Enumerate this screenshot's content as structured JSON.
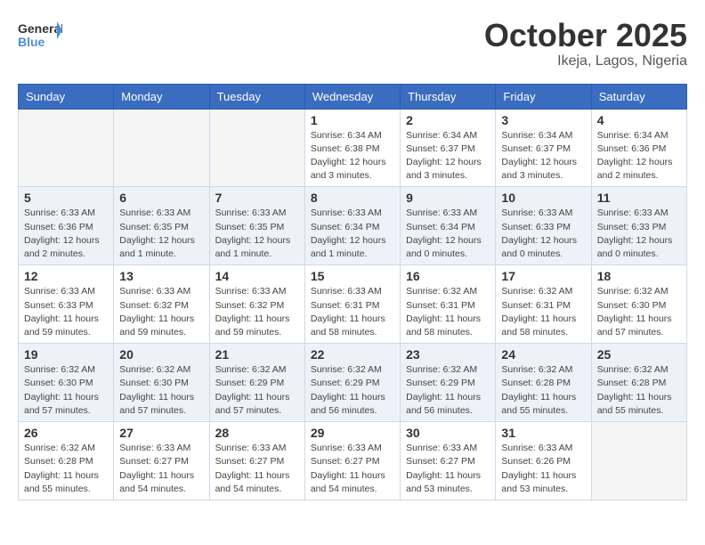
{
  "logo": {
    "line1": "General",
    "line2": "Blue"
  },
  "title": "October 2025",
  "subtitle": "Ikeja, Lagos, Nigeria",
  "weekdays": [
    "Sunday",
    "Monday",
    "Tuesday",
    "Wednesday",
    "Thursday",
    "Friday",
    "Saturday"
  ],
  "weeks": [
    [
      {
        "day": "",
        "empty": true
      },
      {
        "day": "",
        "empty": true
      },
      {
        "day": "",
        "empty": true
      },
      {
        "day": "1",
        "sunrise": "Sunrise: 6:34 AM",
        "sunset": "Sunset: 6:38 PM",
        "daylight": "Daylight: 12 hours and 3 minutes."
      },
      {
        "day": "2",
        "sunrise": "Sunrise: 6:34 AM",
        "sunset": "Sunset: 6:37 PM",
        "daylight": "Daylight: 12 hours and 3 minutes."
      },
      {
        "day": "3",
        "sunrise": "Sunrise: 6:34 AM",
        "sunset": "Sunset: 6:37 PM",
        "daylight": "Daylight: 12 hours and 3 minutes."
      },
      {
        "day": "4",
        "sunrise": "Sunrise: 6:34 AM",
        "sunset": "Sunset: 6:36 PM",
        "daylight": "Daylight: 12 hours and 2 minutes."
      }
    ],
    [
      {
        "day": "5",
        "sunrise": "Sunrise: 6:33 AM",
        "sunset": "Sunset: 6:36 PM",
        "daylight": "Daylight: 12 hours and 2 minutes."
      },
      {
        "day": "6",
        "sunrise": "Sunrise: 6:33 AM",
        "sunset": "Sunset: 6:35 PM",
        "daylight": "Daylight: 12 hours and 1 minute."
      },
      {
        "day": "7",
        "sunrise": "Sunrise: 6:33 AM",
        "sunset": "Sunset: 6:35 PM",
        "daylight": "Daylight: 12 hours and 1 minute."
      },
      {
        "day": "8",
        "sunrise": "Sunrise: 6:33 AM",
        "sunset": "Sunset: 6:34 PM",
        "daylight": "Daylight: 12 hours and 1 minute."
      },
      {
        "day": "9",
        "sunrise": "Sunrise: 6:33 AM",
        "sunset": "Sunset: 6:34 PM",
        "daylight": "Daylight: 12 hours and 0 minutes."
      },
      {
        "day": "10",
        "sunrise": "Sunrise: 6:33 AM",
        "sunset": "Sunset: 6:33 PM",
        "daylight": "Daylight: 12 hours and 0 minutes."
      },
      {
        "day": "11",
        "sunrise": "Sunrise: 6:33 AM",
        "sunset": "Sunset: 6:33 PM",
        "daylight": "Daylight: 12 hours and 0 minutes."
      }
    ],
    [
      {
        "day": "12",
        "sunrise": "Sunrise: 6:33 AM",
        "sunset": "Sunset: 6:33 PM",
        "daylight": "Daylight: 11 hours and 59 minutes."
      },
      {
        "day": "13",
        "sunrise": "Sunrise: 6:33 AM",
        "sunset": "Sunset: 6:32 PM",
        "daylight": "Daylight: 11 hours and 59 minutes."
      },
      {
        "day": "14",
        "sunrise": "Sunrise: 6:33 AM",
        "sunset": "Sunset: 6:32 PM",
        "daylight": "Daylight: 11 hours and 59 minutes."
      },
      {
        "day": "15",
        "sunrise": "Sunrise: 6:33 AM",
        "sunset": "Sunset: 6:31 PM",
        "daylight": "Daylight: 11 hours and 58 minutes."
      },
      {
        "day": "16",
        "sunrise": "Sunrise: 6:32 AM",
        "sunset": "Sunset: 6:31 PM",
        "daylight": "Daylight: 11 hours and 58 minutes."
      },
      {
        "day": "17",
        "sunrise": "Sunrise: 6:32 AM",
        "sunset": "Sunset: 6:31 PM",
        "daylight": "Daylight: 11 hours and 58 minutes."
      },
      {
        "day": "18",
        "sunrise": "Sunrise: 6:32 AM",
        "sunset": "Sunset: 6:30 PM",
        "daylight": "Daylight: 11 hours and 57 minutes."
      }
    ],
    [
      {
        "day": "19",
        "sunrise": "Sunrise: 6:32 AM",
        "sunset": "Sunset: 6:30 PM",
        "daylight": "Daylight: 11 hours and 57 minutes."
      },
      {
        "day": "20",
        "sunrise": "Sunrise: 6:32 AM",
        "sunset": "Sunset: 6:30 PM",
        "daylight": "Daylight: 11 hours and 57 minutes."
      },
      {
        "day": "21",
        "sunrise": "Sunrise: 6:32 AM",
        "sunset": "Sunset: 6:29 PM",
        "daylight": "Daylight: 11 hours and 57 minutes."
      },
      {
        "day": "22",
        "sunrise": "Sunrise: 6:32 AM",
        "sunset": "Sunset: 6:29 PM",
        "daylight": "Daylight: 11 hours and 56 minutes."
      },
      {
        "day": "23",
        "sunrise": "Sunrise: 6:32 AM",
        "sunset": "Sunset: 6:29 PM",
        "daylight": "Daylight: 11 hours and 56 minutes."
      },
      {
        "day": "24",
        "sunrise": "Sunrise: 6:32 AM",
        "sunset": "Sunset: 6:28 PM",
        "daylight": "Daylight: 11 hours and 55 minutes."
      },
      {
        "day": "25",
        "sunrise": "Sunrise: 6:32 AM",
        "sunset": "Sunset: 6:28 PM",
        "daylight": "Daylight: 11 hours and 55 minutes."
      }
    ],
    [
      {
        "day": "26",
        "sunrise": "Sunrise: 6:32 AM",
        "sunset": "Sunset: 6:28 PM",
        "daylight": "Daylight: 11 hours and 55 minutes."
      },
      {
        "day": "27",
        "sunrise": "Sunrise: 6:33 AM",
        "sunset": "Sunset: 6:27 PM",
        "daylight": "Daylight: 11 hours and 54 minutes."
      },
      {
        "day": "28",
        "sunrise": "Sunrise: 6:33 AM",
        "sunset": "Sunset: 6:27 PM",
        "daylight": "Daylight: 11 hours and 54 minutes."
      },
      {
        "day": "29",
        "sunrise": "Sunrise: 6:33 AM",
        "sunset": "Sunset: 6:27 PM",
        "daylight": "Daylight: 11 hours and 54 minutes."
      },
      {
        "day": "30",
        "sunrise": "Sunrise: 6:33 AM",
        "sunset": "Sunset: 6:27 PM",
        "daylight": "Daylight: 11 hours and 53 minutes."
      },
      {
        "day": "31",
        "sunrise": "Sunrise: 6:33 AM",
        "sunset": "Sunset: 6:26 PM",
        "daylight": "Daylight: 11 hours and 53 minutes."
      },
      {
        "day": "",
        "empty": true
      }
    ]
  ]
}
